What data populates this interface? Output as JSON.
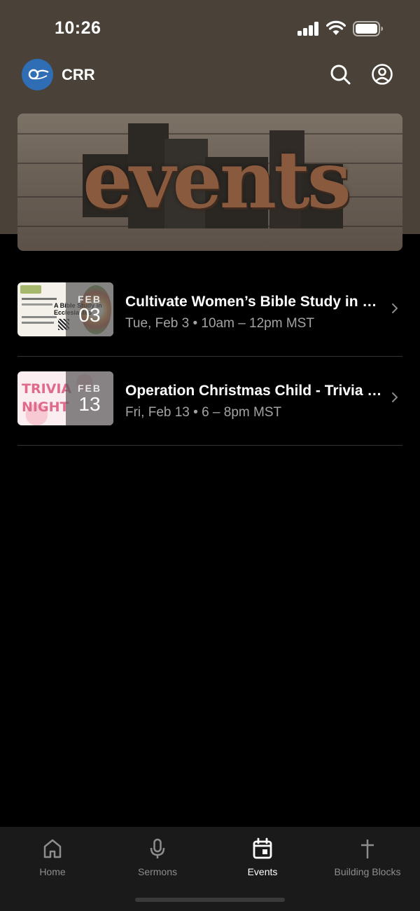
{
  "status_bar": {
    "time": "10:26"
  },
  "app": {
    "title": "CRR"
  },
  "banner": {
    "word": "events"
  },
  "events": [
    {
      "title": "Cultivate Women’s Bible Study in Ecclesiastes",
      "subtitle": "Tue, Feb 3 • 10am – 12pm MST",
      "month": "FEB",
      "day": "03",
      "thumb_text": "A Bible Study in Ecclesiastes"
    },
    {
      "title": "Operation Christmas Child - Trivia Night",
      "subtitle": "Fri, Feb 13 • 6 – 8pm MST",
      "month": "FEB",
      "day": "13",
      "thumb_text": "TRIVIA NIGHT"
    }
  ],
  "tabs": [
    {
      "label": "Home",
      "icon": "home-icon",
      "active": false
    },
    {
      "label": "Sermons",
      "icon": "microphone-icon",
      "active": false
    },
    {
      "label": "Events",
      "icon": "calendar-icon",
      "active": true
    },
    {
      "label": "Building Blocks",
      "icon": "cross-icon",
      "active": false
    }
  ],
  "colors": {
    "header_bg": "#4a4139",
    "accent": "#2f6db5",
    "inactive_tab": "#8d8d8d"
  }
}
